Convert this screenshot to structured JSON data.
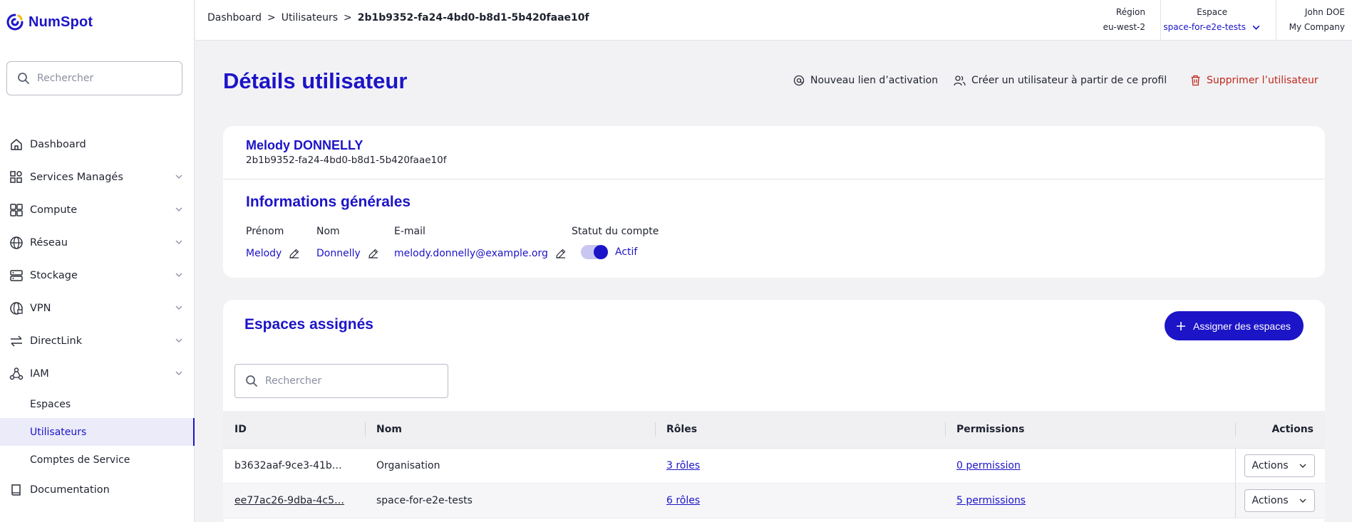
{
  "brand": {
    "name": "NumSpot",
    "color": "#1c14c7"
  },
  "sidebar": {
    "search_placeholder": "Rechercher",
    "items": [
      {
        "label": "Dashboard",
        "icon": "home-icon"
      },
      {
        "label": "Services Managés",
        "icon": "services-icon"
      },
      {
        "label": "Compute",
        "icon": "compute-icon"
      },
      {
        "label": "Réseau",
        "icon": "globe-icon"
      },
      {
        "label": "Stockage",
        "icon": "storage-icon"
      },
      {
        "label": "VPN",
        "icon": "vpn-icon"
      },
      {
        "label": "DirectLink",
        "icon": "directlink-icon"
      },
      {
        "label": "IAM",
        "icon": "iam-icon"
      }
    ],
    "iam_sub": [
      "Espaces",
      "Utilisateurs",
      "Comptes de Service"
    ],
    "documentation": "Documentation"
  },
  "topbar": {
    "breadcrumb": [
      "Dashboard",
      "Utilisateurs",
      "2b1b9352-fa24-4bd0-b8d1-5b420faae10f"
    ],
    "region_label": "Région",
    "region_value": "eu-west-2",
    "space_label": "Espace",
    "space_value": "space-for-e2e-tests",
    "user_name": "John DOE",
    "company": "My Company"
  },
  "page": {
    "title": "Détails utilisateur",
    "actions": {
      "new_link": "Nouveau lien d’activation",
      "create_from": "Créer un utilisateur à partir de ce profil",
      "delete": "Supprimer l’utilisateur"
    }
  },
  "user": {
    "full_name": "Melody DONNELLY",
    "id": "2b1b9352-fa24-4bd0-b8d1-5b420faae10f",
    "section_title": "Informations générales",
    "labels": {
      "first": "Prénom",
      "last": "Nom",
      "email": "E-mail",
      "status": "Statut du compte"
    },
    "first_name": "Melody",
    "last_name": "Donnelly",
    "email": "melody.donnelly@example.org",
    "status": "Actif",
    "status_on": true
  },
  "spaces": {
    "title": "Espaces assignés",
    "assign_button": "Assigner des espaces",
    "search_placeholder": "Rechercher",
    "columns": [
      "ID",
      "Nom",
      "Rôles",
      "Permissions",
      "Actions"
    ],
    "rows": [
      {
        "id": "b3632aaf-9ce3-41b…",
        "name": "Organisation",
        "roles": "3 rôles",
        "permissions": "0 permission",
        "action": "Actions"
      },
      {
        "id": "ee77ac26-9dba-4c5…",
        "name": "space-for-e2e-tests",
        "roles": "6 rôles",
        "permissions": "5 permissions",
        "action": "Actions"
      }
    ]
  }
}
